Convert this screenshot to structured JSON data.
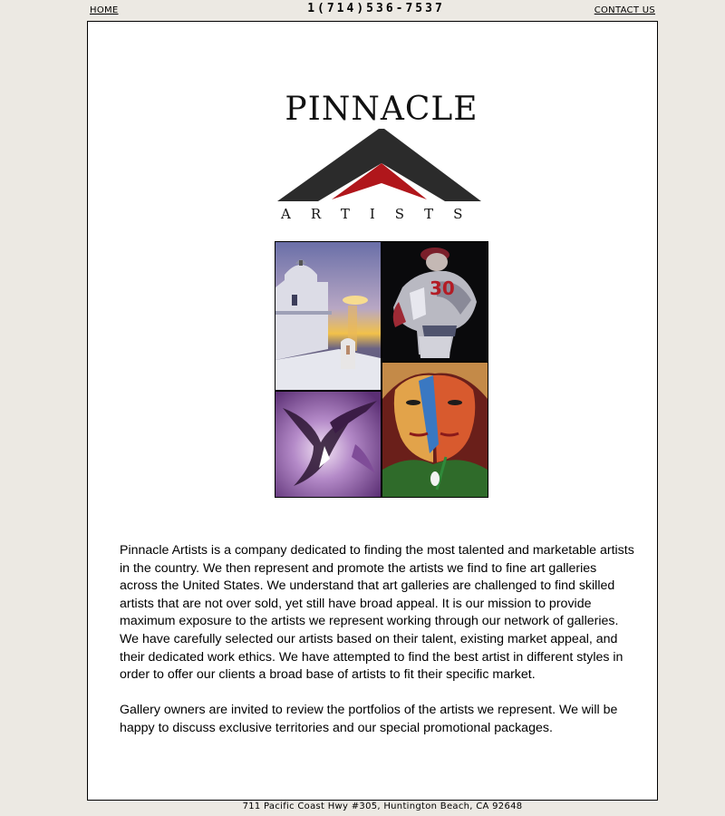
{
  "nav": {
    "home_label": "HOME",
    "phone": "1(714)536-7537",
    "contact_label": "CONTACT US"
  },
  "logo": {
    "title": "PINNACLE",
    "subtitle": "ARTISTS",
    "colors": {
      "dark": "#2b2b2b",
      "accent": "#b0161b"
    }
  },
  "artworks": [
    {
      "name": "santorini-church-painting"
    },
    {
      "name": "baseball-pitcher-painting"
    },
    {
      "name": "purple-abstract-painting"
    },
    {
      "name": "two-faces-portrait-painting"
    }
  ],
  "content": {
    "paragraph1": "Pinnacle Artists is a company dedicated to finding the most talented and marketable artists in the country. We then represent and promote the artists we find to fine art galleries across the United States. We understand that art galleries are challenged to find skilled artists that are not over sold, yet still have broad appeal. It is our mission to provide maximum exposure to the artists we represent working through our network of galleries. We have carefully selected our artists based on their talent, existing market appeal, and their dedicated work ethics. We have attempted to find the best artist in different styles in order to offer our clients a broad base of artists to fit their specific market.",
    "paragraph2": "Gallery owners are invited to review the portfolios of the artists we represent. We will be happy to discuss exclusive territories and our special promotional packages."
  },
  "footer": {
    "address": "711 Pacific Coast Hwy #305, Huntington Beach, CA 92648"
  }
}
